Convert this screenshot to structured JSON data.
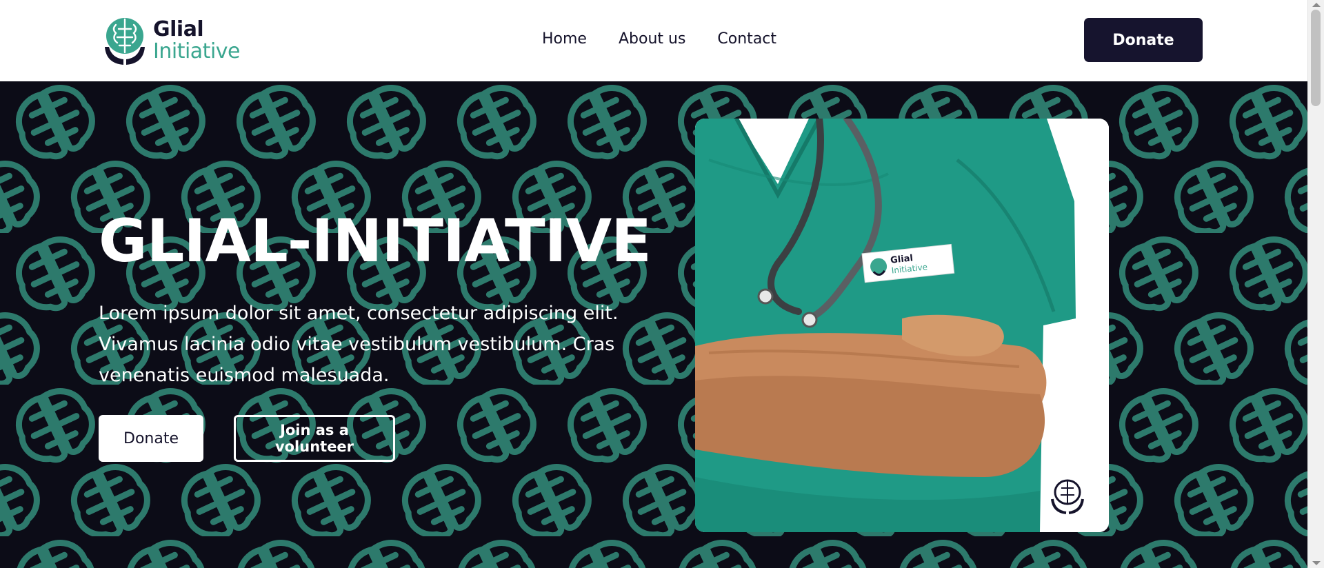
{
  "brand": {
    "name_line1": "Glial",
    "name_line2": "Initiative",
    "primary_color": "#15132b",
    "accent_color": "#3aa68f",
    "logo_icon": "brain-in-hands-icon"
  },
  "nav": {
    "links": [
      {
        "label": "Home"
      },
      {
        "label": "About us"
      },
      {
        "label": "Contact"
      }
    ],
    "donate_label": "Donate"
  },
  "hero": {
    "background_color": "#0c0c17",
    "pattern_color": "#2e7f71",
    "pattern_icon": "brain-icon",
    "title": "GLIAL-INITIATIVE",
    "description": "Lorem ipsum dolor sit amet, consectetur adipiscing elit. Vivamus lacinia odio vitae vestibulum vestibulum. Cras venenatis euismod malesuada.",
    "donate_label": "Donate",
    "volunteer_label": "Join as a volunteer",
    "image": {
      "subject": "doctor-in-teal-scrubs-with-stethoscope",
      "badge_line1": "Glial",
      "badge_line2": "Initiative",
      "corner_icon": "brain-in-hands-icon"
    }
  }
}
